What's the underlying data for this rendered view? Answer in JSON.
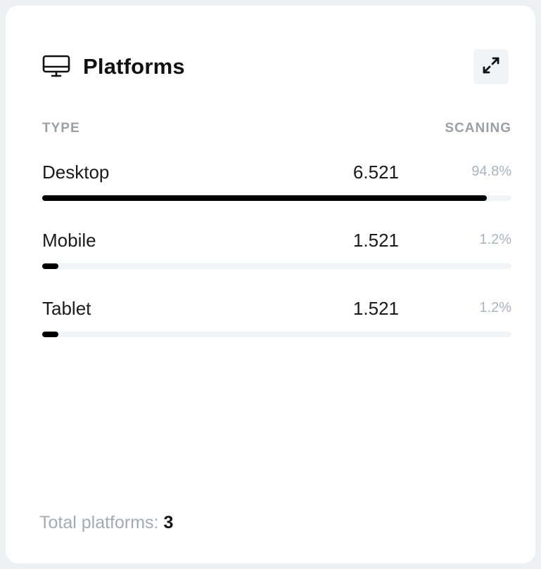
{
  "card": {
    "title": "Platforms",
    "title_icon": "monitor-icon",
    "expand_icon": "expand-icon"
  },
  "columns": {
    "type_label": "TYPE",
    "scanning_label": "SCANING"
  },
  "rows": [
    {
      "label": "Desktop",
      "value": "6.521",
      "percent": "94.8%",
      "fill_fraction": 0.948
    },
    {
      "label": "Mobile",
      "value": "1.521",
      "percent": "1.2%",
      "fill_fraction": 0.035
    },
    {
      "label": "Tablet",
      "value": "1.521",
      "percent": "1.2%",
      "fill_fraction": 0.035
    }
  ],
  "footer": {
    "label": "Total platforms:",
    "count": "3"
  },
  "colors": {
    "bar_fill": "#000000",
    "bar_track": "#f2f4f7",
    "percent_text": "#a9b3c1",
    "muted_text": "#9a9fa6"
  }
}
